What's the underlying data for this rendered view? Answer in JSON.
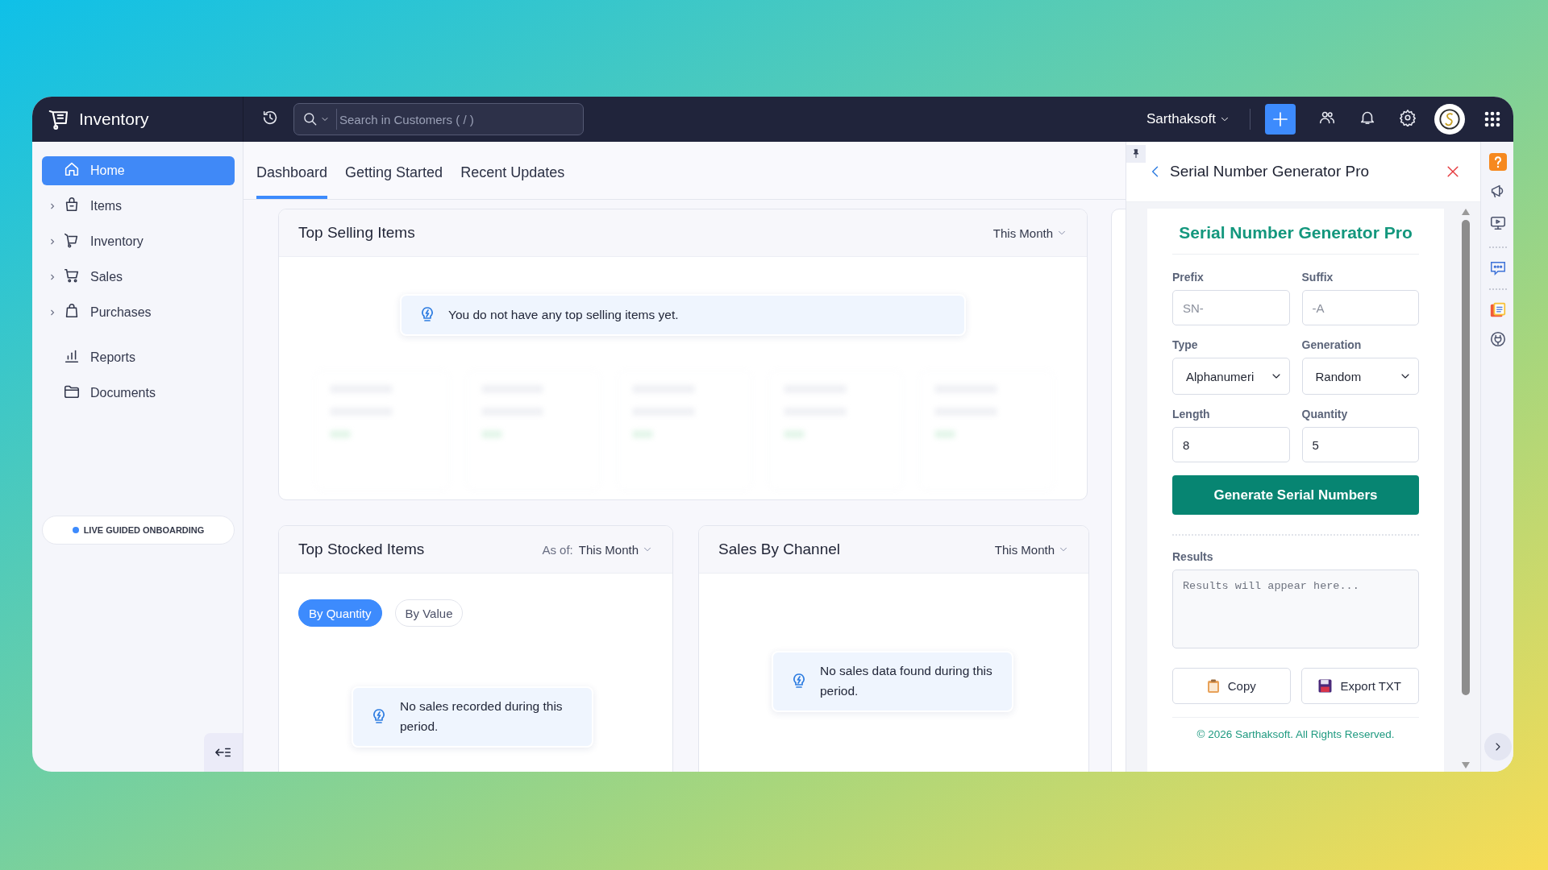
{
  "app": {
    "name": "Inventory"
  },
  "search": {
    "placeholder": "Search in Customers ( / )"
  },
  "org": {
    "label": "Sarthaksoft"
  },
  "sidebar": {
    "items": [
      {
        "label": "Home",
        "expandable": false,
        "selected": true
      },
      {
        "label": "Items",
        "expandable": true,
        "selected": false
      },
      {
        "label": "Inventory",
        "expandable": true,
        "selected": false
      },
      {
        "label": "Sales",
        "expandable": true,
        "selected": false
      },
      {
        "label": "Purchases",
        "expandable": true,
        "selected": false
      },
      {
        "label": "Reports",
        "expandable": false,
        "selected": false
      },
      {
        "label": "Documents",
        "expandable": false,
        "selected": false
      }
    ],
    "onboarding": "LIVE GUIDED ONBOARDING"
  },
  "tabs": [
    {
      "label": "Dashboard",
      "selected": true
    },
    {
      "label": "Getting Started",
      "selected": false
    },
    {
      "label": "Recent Updates",
      "selected": false
    }
  ],
  "cards": [
    {
      "title": "Top Selling Items",
      "period": "This Month",
      "message": "You do not have any top selling items yet."
    },
    {
      "title": "Top Stocked Items",
      "period_label": "As of:",
      "period": "This Month",
      "toggles": [
        {
          "label": "By Quantity",
          "selected": true
        },
        {
          "label": "By Value",
          "selected": false
        }
      ],
      "message": "No sales recorded during this period."
    },
    {
      "title": "Sales By Channel",
      "period": "This Month",
      "message": "No sales data found during this period."
    }
  ],
  "panel": {
    "title": "Serial Number Generator Pro",
    "heading": "Serial Number Generator Pro",
    "fields": [
      {
        "label": "Prefix",
        "kind": "text",
        "placeholder": "SN-"
      },
      {
        "label": "Suffix",
        "kind": "text",
        "placeholder": "-A"
      },
      {
        "label": "Type",
        "kind": "select",
        "value": "Alphanumeri"
      },
      {
        "label": "Generation",
        "kind": "select",
        "value": "Random"
      },
      {
        "label": "Length",
        "kind": "text",
        "value": "8"
      },
      {
        "label": "Quantity",
        "kind": "text",
        "value": "5"
      }
    ],
    "generate_button": "Generate Serial Numbers",
    "results_label": "Results",
    "results_placeholder": "Results will appear here...",
    "buttons": [
      "Copy",
      "Export TXT"
    ],
    "footer": "© 2026 Sarthaksoft. All Rights Reserved."
  }
}
